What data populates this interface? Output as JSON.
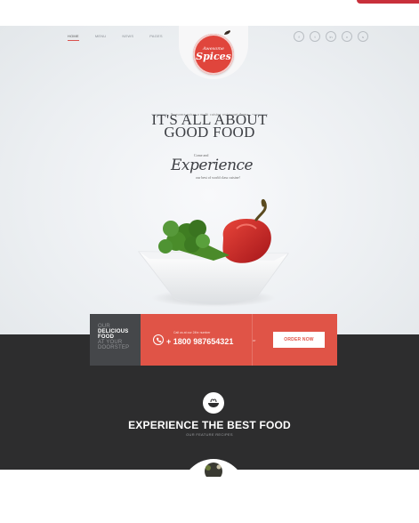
{
  "nav": {
    "items": [
      "HOME",
      "MENU",
      "NEWS",
      "PAGES"
    ],
    "active_index": 0
  },
  "logo": {
    "line1": "Awesome",
    "line2": "Spices"
  },
  "social": {
    "icons": [
      "facebook-icon",
      "twitter-icon",
      "linkedin-icon",
      "vimeo-icon",
      "skype-icon"
    ],
    "glyphs": [
      "f",
      "t",
      "in",
      "v",
      "s"
    ]
  },
  "hero": {
    "tagline": "Awesome spices a multi cuisine restaurant theme",
    "headline_line1": "IT'S ALL ABOUT",
    "headline_line2": "GOOD FOOD",
    "come_and": "Come and",
    "experience": "Experience",
    "world_class": "our best of world class cuisine!"
  },
  "cta": {
    "left_lines": [
      "OUR",
      "DELICIOUS",
      "FOOD",
      "AT YOUR",
      "DOORSTEP"
    ],
    "call_label": "Call us at our 24hr number",
    "phone": "+ 1800 987654321",
    "or": "or",
    "order_button": "ORDER NOW"
  },
  "section": {
    "title": "EXPERIENCE THE BEST FOOD",
    "subtitle": "OUR FEATURE RECIPES"
  },
  "colors": {
    "accent": "#e05447",
    "dark": "#2d2d2e",
    "panel": "#45474a"
  }
}
